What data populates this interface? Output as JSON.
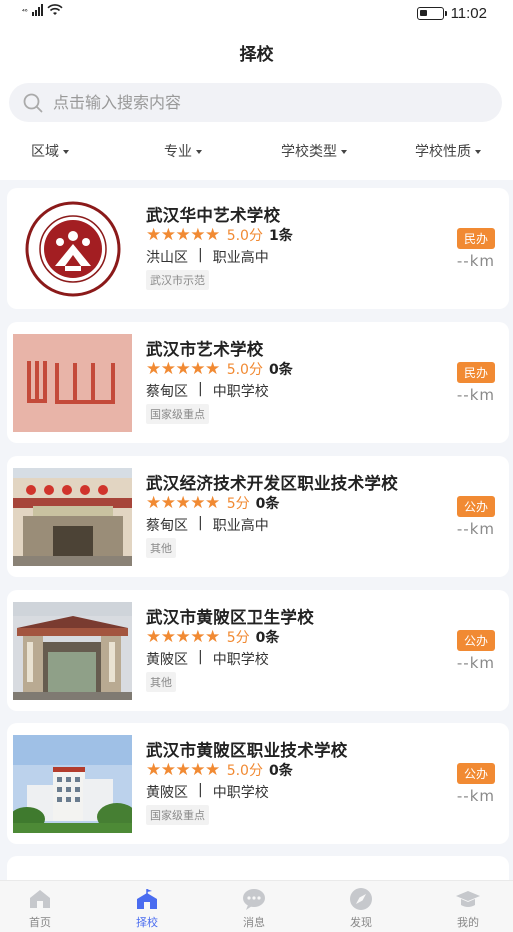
{
  "status_bar": {
    "signal": "⁴⁶",
    "time": "11:02",
    "battery_level": 0.25
  },
  "header": {
    "title": "择校"
  },
  "search": {
    "placeholder": "点击输入搜索内容"
  },
  "filters": [
    {
      "label": "区域"
    },
    {
      "label": "专业"
    },
    {
      "label": "学校类型"
    },
    {
      "label": "学校性质"
    }
  ],
  "schools": [
    {
      "name": "武汉华中艺术学校",
      "stars": "★★★★★",
      "score": "5.0分",
      "count": "1条",
      "district": "洪山区",
      "separator": "|",
      "type": "职业高中",
      "tag": "武汉市示范",
      "nature": "民办",
      "distance": "--km",
      "image": "logo-emblem"
    },
    {
      "name": "武汉市艺术学校",
      "stars": "★★★★★",
      "score": "5.0分",
      "count": "0条",
      "district": "蔡甸区",
      "separator": "|",
      "type": "中职学校",
      "tag": "国家级重点",
      "nature": "民办",
      "distance": "--km",
      "image": "red-brush-logo"
    },
    {
      "name": "武汉经济技术开发区职业技术学校",
      "stars": "★★★★★",
      "score": "5分",
      "count": "0条",
      "district": "蔡甸区",
      "separator": "|",
      "type": "职业高中",
      "tag": "其他",
      "nature": "公办",
      "distance": "--km",
      "image": "school-gate-lanterns"
    },
    {
      "name": "武汉市黄陂区卫生学校",
      "stars": "★★★★★",
      "score": "5分",
      "count": "0条",
      "district": "黄陂区",
      "separator": "|",
      "type": "中职学校",
      "tag": "其他",
      "nature": "公办",
      "distance": "--km",
      "image": "school-gate-tiled-roof"
    },
    {
      "name": "武汉市黄陂区职业技术学校",
      "stars": "★★★★★",
      "score": "5.0分",
      "count": "0条",
      "district": "黄陂区",
      "separator": "|",
      "type": "中职学校",
      "tag": "国家级重点",
      "nature": "公办",
      "distance": "--km",
      "image": "campus-building-sky"
    }
  ],
  "tabbar": [
    {
      "label": "首页",
      "icon": "home-icon"
    },
    {
      "label": "择校",
      "icon": "school-icon",
      "active": true
    },
    {
      "label": "消息",
      "icon": "message-icon"
    },
    {
      "label": "发现",
      "icon": "compass-icon"
    },
    {
      "label": "我的",
      "icon": "graduation-cap-icon"
    }
  ],
  "colors": {
    "accent": "#f18a33",
    "active_tab": "#4a6cf0",
    "background": "#f3f5f9"
  }
}
